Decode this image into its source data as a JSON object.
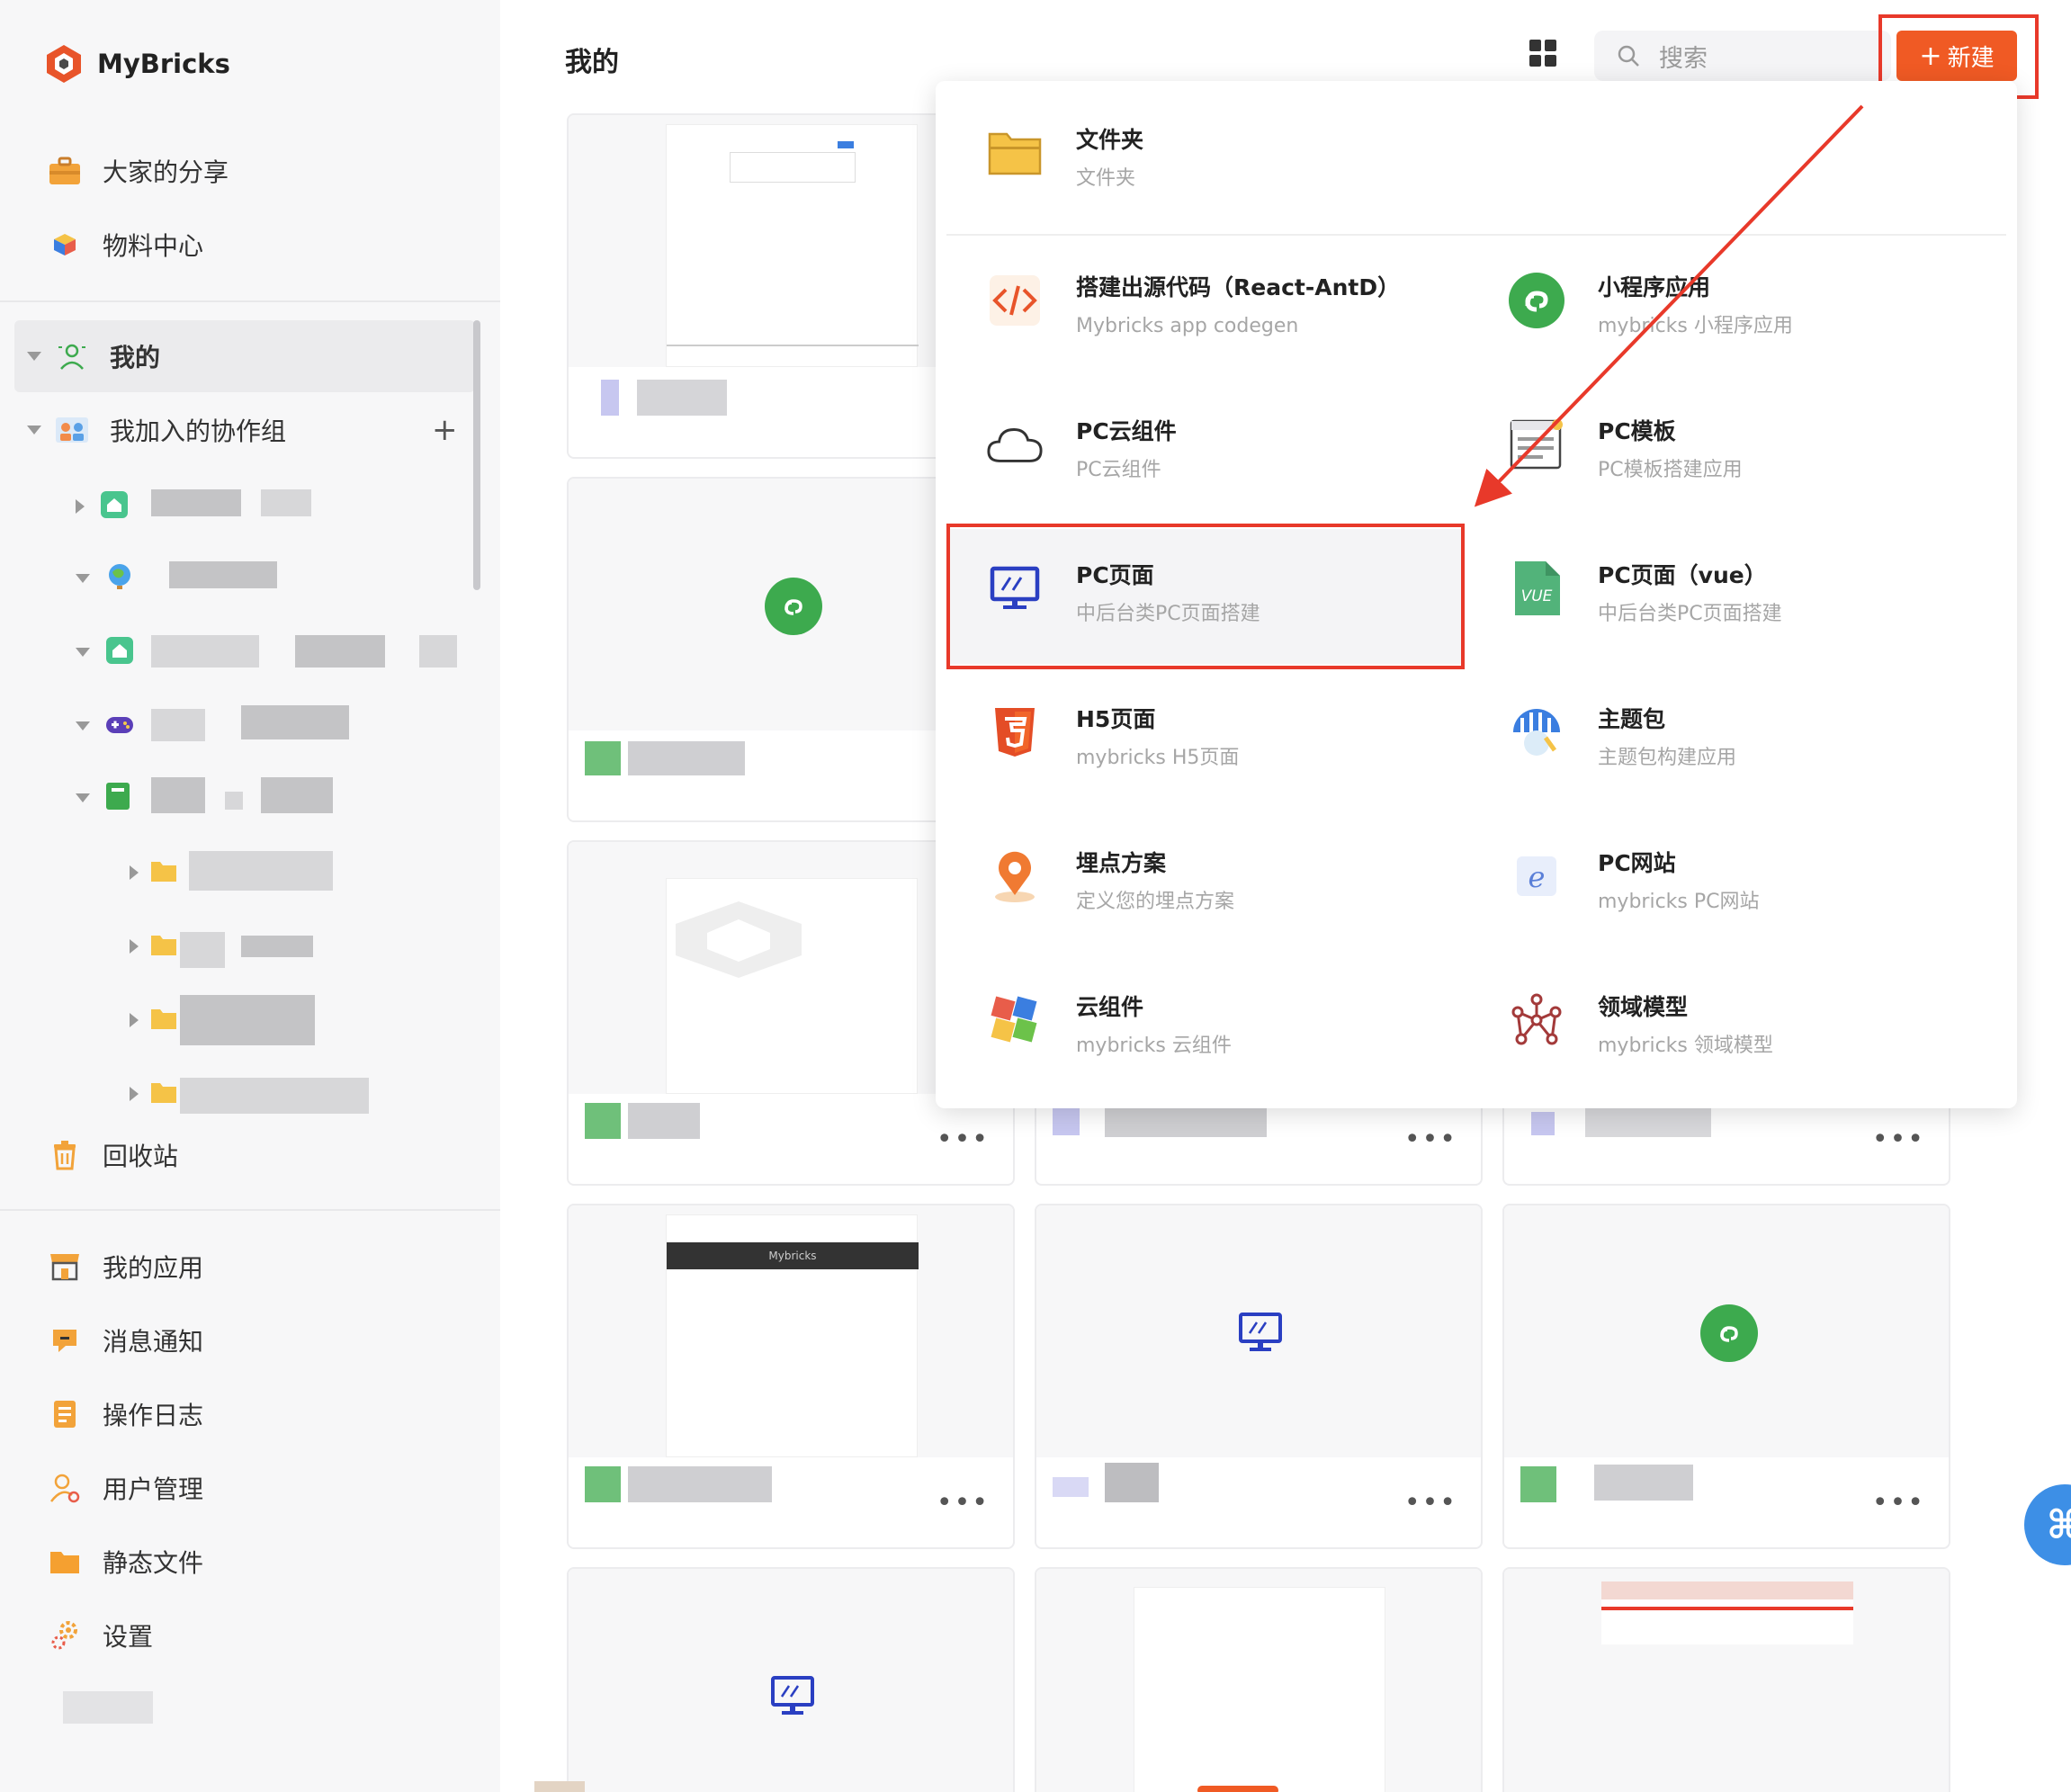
{
  "app": {
    "name": "MyBricks"
  },
  "sidebar": {
    "top_items": [
      {
        "label": "大家的分享",
        "icon": "briefcase-icon"
      },
      {
        "label": "物料中心",
        "icon": "cube-icon"
      }
    ],
    "my": {
      "label": "我的",
      "icon": "user-icon"
    },
    "groups": {
      "label": "我加入的协作组",
      "add_symbol": "+"
    },
    "recycle": {
      "label": "回收站",
      "icon": "trash-icon"
    },
    "bottom_items": [
      {
        "label": "我的应用",
        "icon": "store-icon"
      },
      {
        "label": "消息通知",
        "icon": "message-icon"
      },
      {
        "label": "操作日志",
        "icon": "log-icon"
      },
      {
        "label": "用户管理",
        "icon": "user-manage-icon"
      },
      {
        "label": "静态文件",
        "icon": "folder-icon"
      },
      {
        "label": "设置",
        "icon": "gear-icon"
      }
    ]
  },
  "header": {
    "title": "我的",
    "search_placeholder": "搜索",
    "new_button": "新建",
    "new_symbol": "+"
  },
  "dropdown": {
    "folder": {
      "title": "文件夹",
      "desc": "文件夹"
    },
    "items": [
      {
        "title": "搭建出源代码（React-AntD）",
        "desc": "Mybricks app codegen",
        "icon": "code-icon"
      },
      {
        "title": "小程序应用",
        "desc": "mybricks 小程序应用",
        "icon": "miniprogram-icon"
      },
      {
        "title": "PC云组件",
        "desc": "PC云组件",
        "icon": "cloud-icon"
      },
      {
        "title": "PC模板",
        "desc": "PC模板搭建应用",
        "icon": "template-icon"
      },
      {
        "title": "PC页面",
        "desc": "中后台类PC页面搭建",
        "icon": "monitor-icon"
      },
      {
        "title": "PC页面（vue）",
        "desc": "中后台类PC页面搭建",
        "icon": "vue-icon"
      },
      {
        "title": "H5页面",
        "desc": "mybricks H5页面",
        "icon": "html5-icon"
      },
      {
        "title": "主题包",
        "desc": "主题包构建应用",
        "icon": "theme-icon"
      },
      {
        "title": "埋点方案",
        "desc": "定义您的埋点方案",
        "icon": "location-pin-icon"
      },
      {
        "title": "PC网站",
        "desc": "mybricks PC网站",
        "icon": "browser-icon"
      },
      {
        "title": "云组件",
        "desc": "mybricks 云组件",
        "icon": "puzzle-icon"
      },
      {
        "title": "领域模型",
        "desc": "mybricks 领域模型",
        "icon": "domain-model-icon"
      }
    ]
  },
  "cards": {
    "more_label": "•••",
    "thumb_bar_label": "Mybricks"
  },
  "colors": {
    "accent": "#f05a24",
    "highlight": "#e8392a",
    "mini_green": "#3daa4e",
    "monitor_blue": "#2a3fc2"
  }
}
